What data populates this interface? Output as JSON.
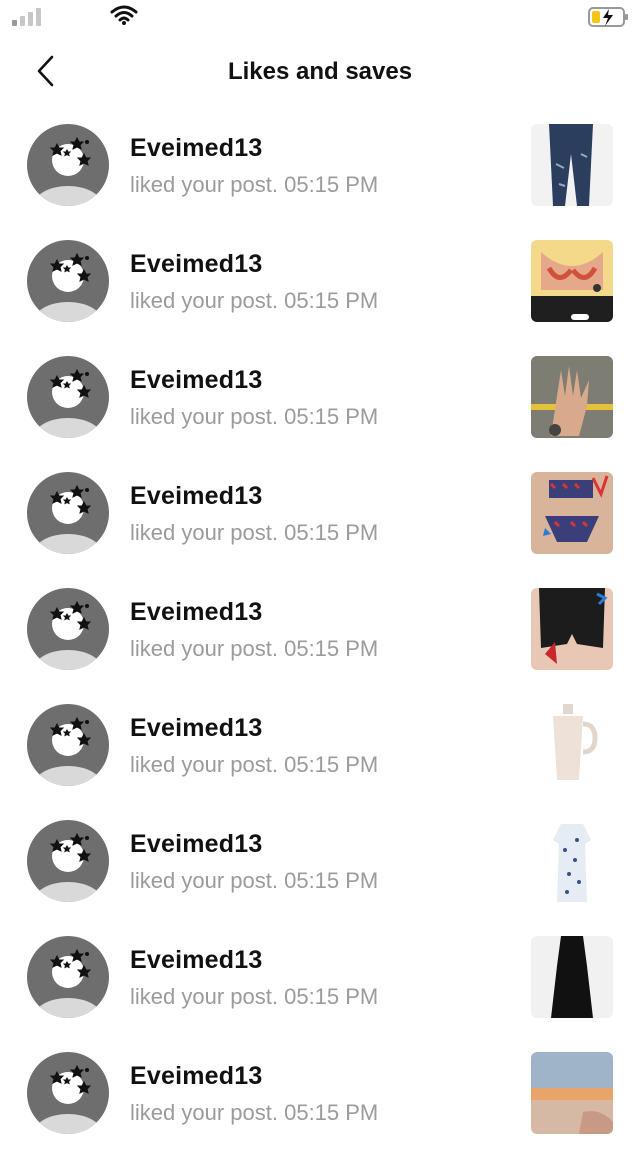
{
  "header": {
    "title": "Likes and saves"
  },
  "notifications": [
    {
      "username": "Eveimed13",
      "action": "liked your post.",
      "time": "05:15 PM",
      "thumbnail": "jeans"
    },
    {
      "username": "Eveimed13",
      "action": "liked your post.",
      "time": "05:15 PM",
      "thumbnail": "bikini-top"
    },
    {
      "username": "Eveimed13",
      "action": "liked your post.",
      "time": "05:15 PM",
      "thumbnail": "nails-hand"
    },
    {
      "username": "Eveimed13",
      "action": "liked your post.",
      "time": "05:15 PM",
      "thumbnail": "swimsuit"
    },
    {
      "username": "Eveimed13",
      "action": "liked your post.",
      "time": "05:15 PM",
      "thumbnail": "denim-shorts"
    },
    {
      "username": "Eveimed13",
      "action": "liked your post.",
      "time": "05:15 PM",
      "thumbnail": "tumbler"
    },
    {
      "username": "Eveimed13",
      "action": "liked your post.",
      "time": "05:15 PM",
      "thumbnail": "floral-dress"
    },
    {
      "username": "Eveimed13",
      "action": "liked your post.",
      "time": "05:15 PM",
      "thumbnail": "black-jumpsuit"
    },
    {
      "username": "Eveimed13",
      "action": "liked your post.",
      "time": "05:15 PM",
      "thumbnail": "beach-sunset"
    }
  ],
  "colors": {
    "background": "#ffffff",
    "text": "#111111",
    "secondary_text": "#9b9b9b",
    "avatar_bg": "#6e6e6e",
    "battery_charge": "#f5c518"
  }
}
